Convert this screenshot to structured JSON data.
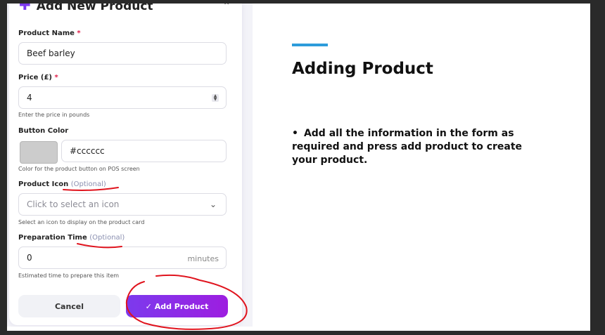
{
  "form": {
    "title": "Add New Product",
    "product_name": {
      "label": "Product Name",
      "required": "*",
      "value": "Beef barley"
    },
    "price": {
      "label": "Price (£)",
      "required": "*",
      "value": "4",
      "hint": "Enter the price in pounds"
    },
    "button_color": {
      "label": "Button Color",
      "value": "#cccccc",
      "swatch": "#cccccc",
      "hint": "Color for the product button on POS screen"
    },
    "product_icon": {
      "label": "Product Icon",
      "optional": "(Optional)",
      "placeholder": "Click to select an icon",
      "hint": "Select an icon to display on the product card"
    },
    "prep_time": {
      "label": "Preparation Time",
      "optional": "(Optional)",
      "value": "0",
      "suffix": "minutes",
      "hint": "Estimated time to prepare this item"
    },
    "cancel_label": "Cancel",
    "add_label": "✓ Add Product"
  },
  "slide": {
    "heading": "Adding Product",
    "bullet": "Add all the information in the form as required and press add product to create your product."
  },
  "colors": {
    "accent_bar": "#2d9cdb",
    "primary": "#7c3aed",
    "annotation": "#e0141e"
  },
  "icons": [
    "plus-icon",
    "chevron-up-icon",
    "stepper-icon",
    "chevron-down-icon"
  ]
}
